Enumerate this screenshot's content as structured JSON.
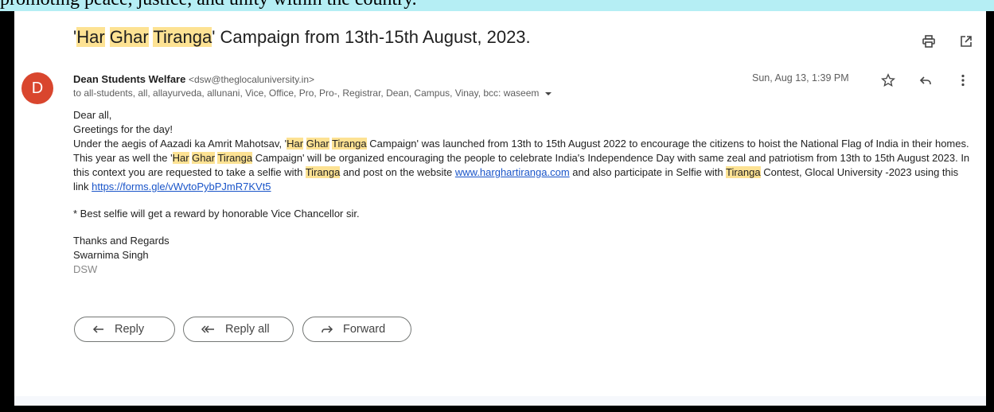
{
  "page_caption": "promoting peace, justice, and unity within the country.",
  "email": {
    "subject": {
      "open_quote": "'",
      "hl1": "Har",
      "space1": " ",
      "hl2": "Ghar",
      "space2": " ",
      "hl3": "Tiranga",
      "rest": "' Campaign from 13th-15th August, 2023."
    },
    "sender": {
      "avatar_letter": "D",
      "avatar_color": "#d9462e",
      "name": "Dean Students Welfare",
      "email": "<dsw@theglocaluniversity.in>",
      "recipients": "to all-students, all, allayurveda, allunani, Vice, Office, Pro, Pro-, Registrar, Dean, Campus, Vinay, bcc: waseem",
      "date": "Sun, Aug 13, 1:39 PM"
    },
    "icons": {
      "print": "print-icon",
      "open_new": "open-in-new-icon",
      "star": "star-icon",
      "reply": "reply-icon",
      "more": "more-vert-icon",
      "recipients_toggle": "caret-down-icon"
    },
    "body": {
      "greeting": "Dear all,",
      "greeting2": "Greetings for the day!",
      "p1_a": "Under the aegis of Aazadi ka Amrit Mahotsav, '",
      "p1_hl1": "Har",
      "p1_hl2": "Ghar",
      "p1_hl3": "Tiranga",
      "p1_b": " Campaign' was launched from 13th to 15th August 2022 to encourage the citizens to hoist the National Flag of India in their homes. This year as well the '",
      "p1_hl4": "Har",
      "p1_hl5": "Ghar",
      "p1_hl6": "Tiranga",
      "p1_c": " Campaign' will be organized encouraging the people to celebrate India's Independence Day with same zeal and patriotism from 13th to 15th August 2023. In this context you are requested to take a selfie with ",
      "p1_hl7": "Tiranga",
      "p1_d": " and post on the website ",
      "link1": "www.harghartiranga.com",
      "p1_e": " and also participate in Selfie with ",
      "p1_hl8": "Tiranga",
      "p1_f": " Contest, Glocal University -2023 using this link  ",
      "link2": "https://forms.gle/vWvtoPybPJmR7KVt5",
      "note": "* Best selfie will get a reward by honorable Vice Chancellor sir.",
      "closing": "Thanks and Regards",
      "signature_name": "Swarnima Singh",
      "signature_title": "DSW"
    },
    "actions": {
      "reply": "Reply",
      "reply_all": "Reply all",
      "forward": "Forward"
    }
  }
}
